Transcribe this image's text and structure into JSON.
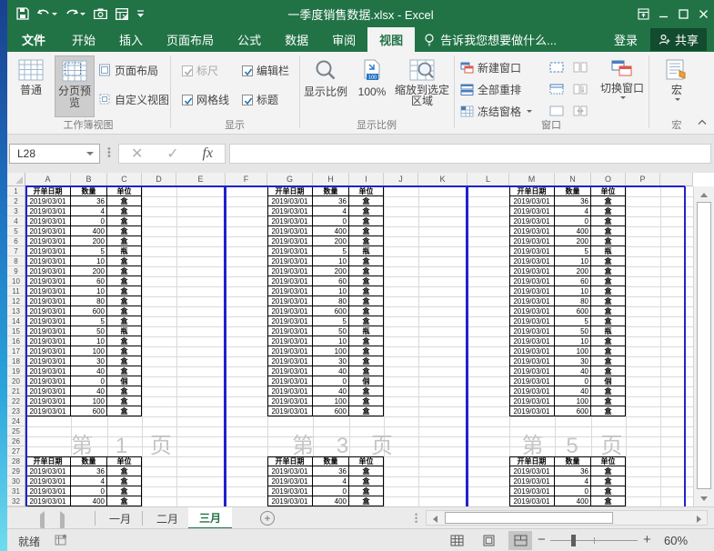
{
  "titlebar": {
    "title": "一季度销售数据.xlsx - Excel"
  },
  "ribbon_tabs": {
    "file": "文件",
    "tabs": [
      "开始",
      "插入",
      "页面布局",
      "公式",
      "数据",
      "审阅",
      "视图"
    ],
    "active": "视图",
    "tellme": "告诉我您想要做什么...",
    "signin": "登录",
    "share": "共享"
  },
  "ribbon": {
    "workbook_views": {
      "label": "工作簿视图",
      "normal": "普通",
      "page_break_preview": "分页预览",
      "page_layout": "页面布局",
      "custom_views": "自定义视图"
    },
    "show": {
      "label": "显示",
      "ruler": "标尺",
      "formula_bar": "编辑栏",
      "gridlines": "网格线",
      "headings": "标题"
    },
    "zoom": {
      "label": "显示比例",
      "zoom": "显示比例",
      "hundred": "100%",
      "zoom_to_selection": "缩放到选定区域"
    },
    "window": {
      "label": "窗口",
      "new_window": "新建窗口",
      "arrange_all": "全部重排",
      "freeze_panes": "冻结窗格",
      "switch_windows": "切换窗口"
    },
    "macros": {
      "label": "宏",
      "macros": "宏"
    }
  },
  "formula_bar": {
    "name_box": "L28",
    "fx": "fx",
    "formula": ""
  },
  "grid": {
    "columns": [
      "A",
      "B",
      "C",
      "D",
      "E",
      "F",
      "G",
      "H",
      "I",
      "J",
      "K",
      "L",
      "M",
      "N",
      "O",
      "P"
    ],
    "visible_rows": 32,
    "selected_cell": "L28",
    "watermarks": [
      "第 1 页",
      "第 3 页",
      "第 5 页"
    ],
    "table": {
      "headers": [
        "开单日期",
        "数量",
        "单位"
      ],
      "rows": [
        [
          "2019/03/01",
          "36",
          "盒"
        ],
        [
          "2019/03/01",
          "4",
          "盒"
        ],
        [
          "2019/03/01",
          "0",
          "盒"
        ],
        [
          "2019/03/01",
          "400",
          "盒"
        ],
        [
          "2019/03/01",
          "200",
          "盒"
        ],
        [
          "2019/03/01",
          "5",
          "瓶"
        ],
        [
          "2019/03/01",
          "10",
          "盒"
        ],
        [
          "2019/03/01",
          "200",
          "盒"
        ],
        [
          "2019/03/01",
          "60",
          "盒"
        ],
        [
          "2019/03/01",
          "10",
          "盒"
        ],
        [
          "2019/03/01",
          "80",
          "盒"
        ],
        [
          "2019/03/01",
          "600",
          "盒"
        ],
        [
          "2019/03/01",
          "5",
          "盒"
        ],
        [
          "2019/03/01",
          "50",
          "瓶"
        ],
        [
          "2019/03/01",
          "10",
          "盒"
        ],
        [
          "2019/03/01",
          "100",
          "盒"
        ],
        [
          "2019/03/01",
          "30",
          "盒"
        ],
        [
          "2019/03/01",
          "40",
          "盒"
        ],
        [
          "2019/03/01",
          "0",
          "個"
        ],
        [
          "2019/03/01",
          "40",
          "盒"
        ],
        [
          "2019/03/01",
          "100",
          "盒"
        ],
        [
          "2019/03/01",
          "600",
          "盒"
        ]
      ],
      "rows_block2": [
        [
          "2019/03/01",
          "36",
          "盒"
        ],
        [
          "2019/03/01",
          "4",
          "盒"
        ],
        [
          "2019/03/01",
          "0",
          "盒"
        ],
        [
          "2019/03/01",
          "400",
          "盒"
        ]
      ]
    }
  },
  "sheet_tabs": {
    "tabs": [
      "一月",
      "二月",
      "三月"
    ],
    "active": "三月"
  },
  "status_bar": {
    "ready": "就绪",
    "zoom_level": "60%"
  },
  "colors": {
    "excel_green": "#217346",
    "page_break_blue": "#2121ce",
    "watermark_gray": "#c4c4c4",
    "ribbon_bg": "#f3f3f3"
  }
}
